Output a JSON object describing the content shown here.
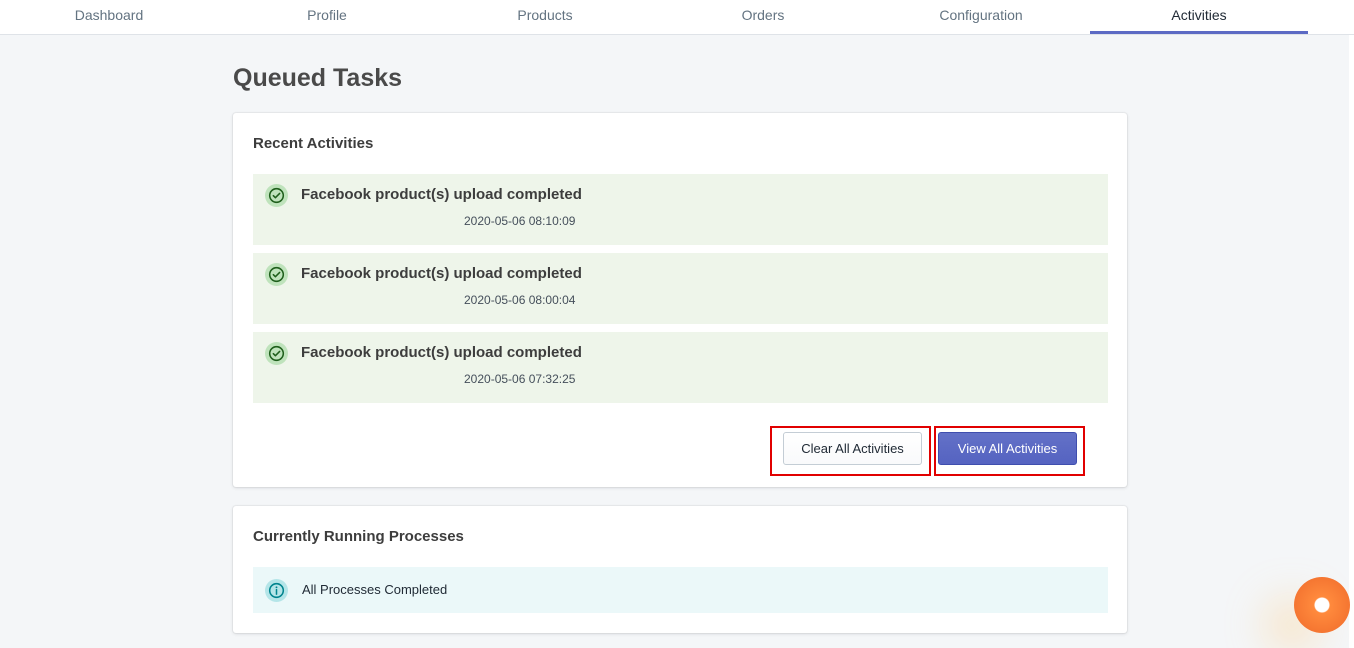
{
  "nav": {
    "tabs": [
      {
        "label": "Dashboard"
      },
      {
        "label": "Profile"
      },
      {
        "label": "Products"
      },
      {
        "label": "Orders"
      },
      {
        "label": "Configuration"
      },
      {
        "label": "Activities",
        "active": true
      }
    ]
  },
  "page": {
    "title": "Queued Tasks"
  },
  "recent_activities": {
    "title": "Recent Activities",
    "items": [
      {
        "text": "Facebook product(s) upload completed",
        "time": "2020-05-06 08:10:09",
        "icon": "check-circle-icon"
      },
      {
        "text": "Facebook product(s) upload completed",
        "time": "2020-05-06 08:00:04",
        "icon": "check-circle-icon"
      },
      {
        "text": "Facebook product(s) upload completed",
        "time": "2020-05-06 07:32:25",
        "icon": "check-circle-icon"
      }
    ],
    "clear_button": "Clear All Activities",
    "view_button": "View All Activities"
  },
  "running_processes": {
    "title": "Currently Running Processes",
    "status": "All Processes Completed",
    "icon": "info-circle-icon"
  },
  "colors": {
    "accent": "#5c6ac4",
    "success_bg": "#eef5ea",
    "info_bg": "#ebf8f9",
    "highlight": "#e10000"
  }
}
